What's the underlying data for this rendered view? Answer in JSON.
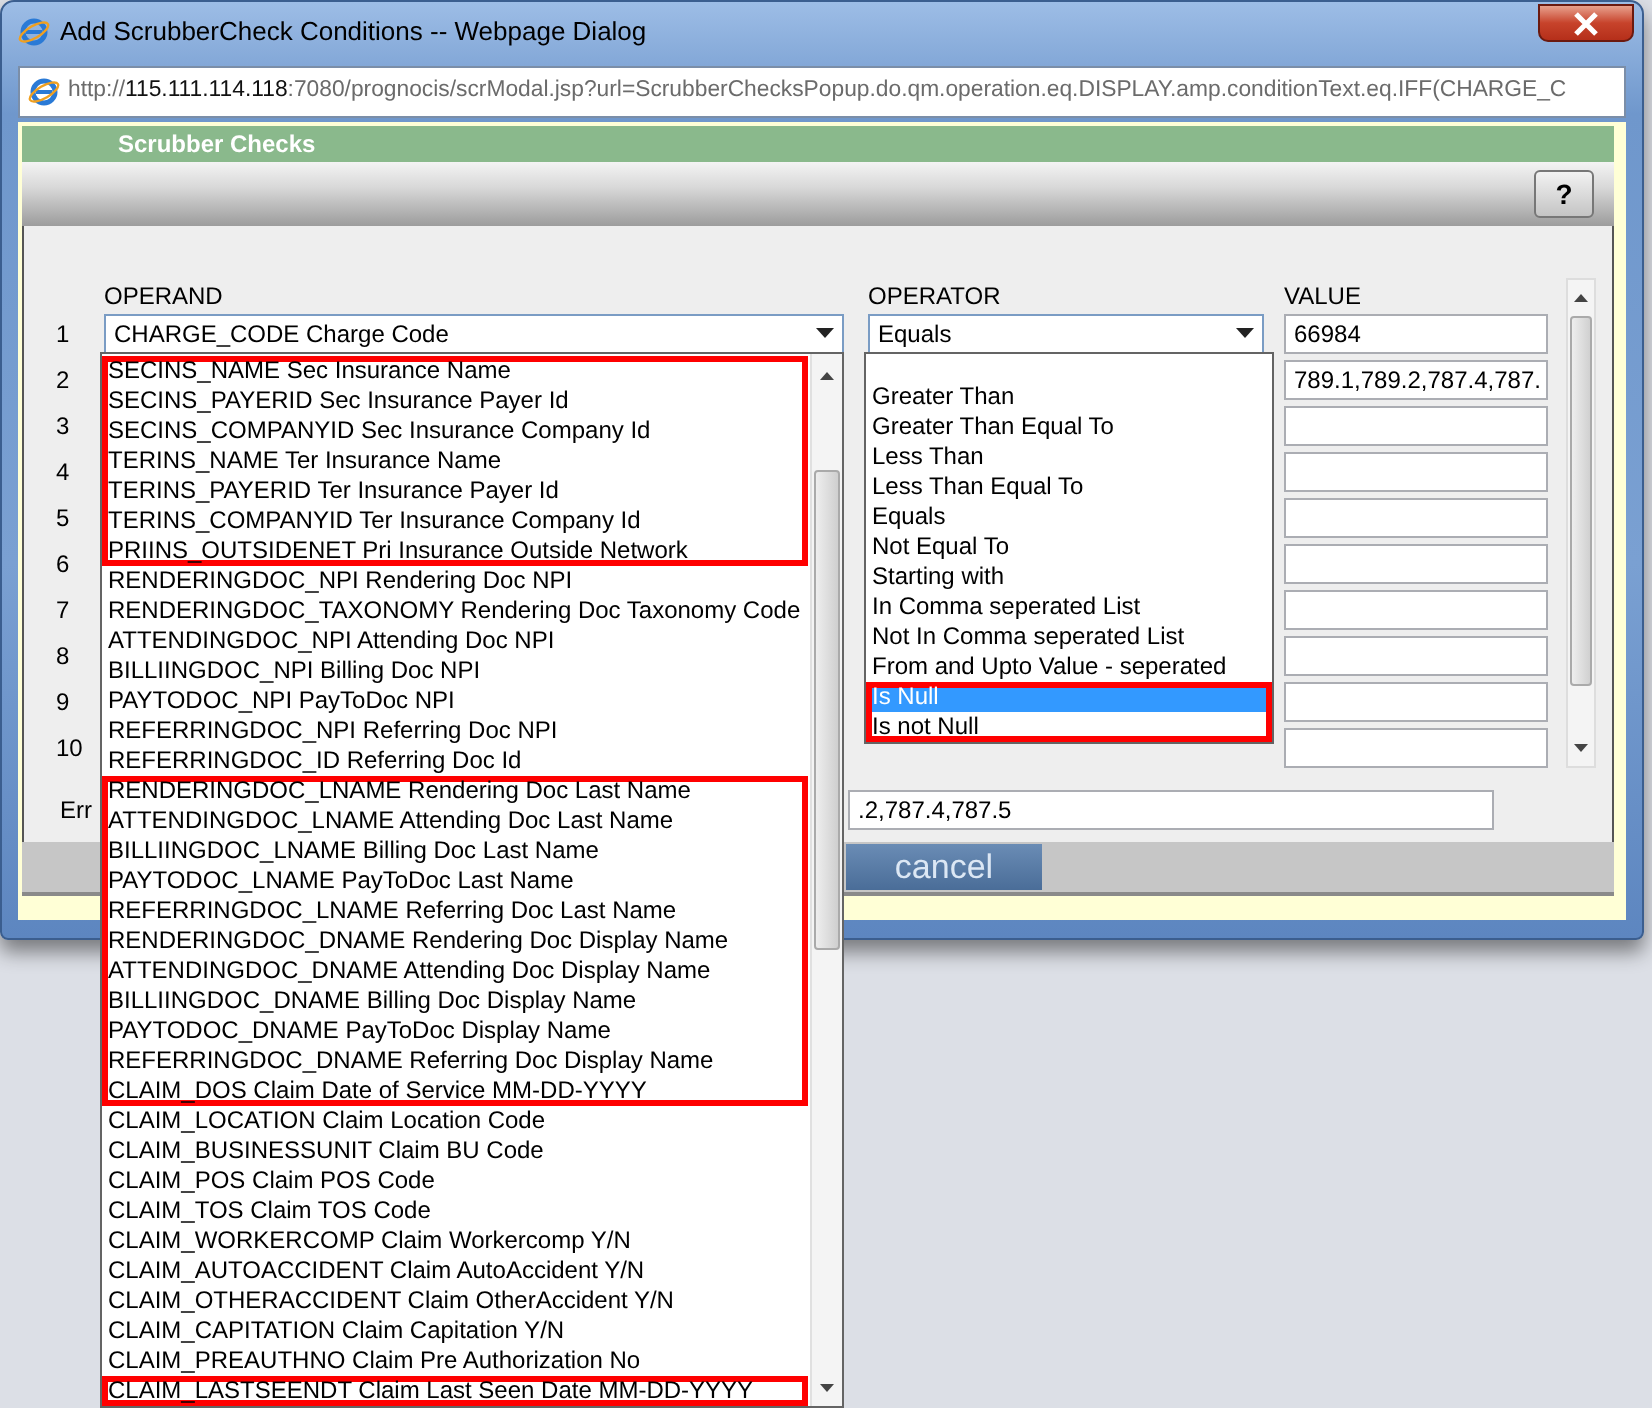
{
  "window": {
    "title": "Add ScrubberCheck Conditions -- Webpage Dialog"
  },
  "address": {
    "scheme": "http://",
    "host": "115.111.114.118",
    "rest": ":7080/prognocis/scrModal.jsp?url=ScrubberChecksPopup.do.qm.operation.eq.DISPLAY.amp.conditionText.eq.IFF(CHARGE_C"
  },
  "header": {
    "title": "Scrubber Checks",
    "help_button": "?"
  },
  "columns": [
    "OPERAND",
    "OPERATOR",
    "VALUE"
  ],
  "rows": [
    {
      "number": "1",
      "operand": "CHARGE_CODE Charge Code",
      "operator": "Equals",
      "value": "66984"
    },
    {
      "number": "2",
      "value": "789.1,789.2,787.4,787."
    },
    {
      "number": "3"
    },
    {
      "number": "4"
    },
    {
      "number": "5"
    },
    {
      "number": "6"
    },
    {
      "number": "7"
    },
    {
      "number": "8"
    },
    {
      "number": "9"
    },
    {
      "number": "10"
    }
  ],
  "error": {
    "label": "Err",
    "value": ".2,787.4,787.5"
  },
  "cancel_button": "cancel",
  "operand_list": {
    "items": [
      {
        "label": "SECINS_NAME Sec Insurance Name",
        "highlighted": true
      },
      {
        "label": "SECINS_PAYERID Sec Insurance Payer Id",
        "highlighted": true
      },
      {
        "label": "SECINS_COMPANYID Sec Insurance Company Id",
        "highlighted": true
      },
      {
        "label": "TERINS_NAME Ter Insurance Name",
        "highlighted": true
      },
      {
        "label": "TERINS_PAYERID Ter Insurance Payer Id",
        "highlighted": true
      },
      {
        "label": "TERINS_COMPANYID Ter Insurance Company Id",
        "highlighted": true
      },
      {
        "label": "PRIINS_OUTSIDENET Pri Insurance Outside Network",
        "highlighted": true
      },
      {
        "label": "RENDERINGDOC_NPI Rendering Doc NPI",
        "highlighted": false
      },
      {
        "label": "RENDERINGDOC_TAXONOMY Rendering Doc Taxonomy Code",
        "highlighted": false
      },
      {
        "label": "ATTENDINGDOC_NPI Attending Doc NPI",
        "highlighted": false
      },
      {
        "label": "BILLIINGDOC_NPI Billing Doc NPI",
        "highlighted": false
      },
      {
        "label": "PAYTODOC_NPI PayToDoc NPI",
        "highlighted": false
      },
      {
        "label": "REFERRINGDOC_NPI Referring Doc NPI",
        "highlighted": false
      },
      {
        "label": "REFERRINGDOC_ID Referring Doc Id",
        "highlighted": false
      },
      {
        "label": "RENDERINGDOC_LNAME Rendering Doc Last Name",
        "highlighted": true
      },
      {
        "label": "ATTENDINGDOC_LNAME Attending Doc Last Name",
        "highlighted": true
      },
      {
        "label": "BILLIINGDOC_LNAME Billing Doc Last Name",
        "highlighted": true
      },
      {
        "label": "PAYTODOC_LNAME PayToDoc Last Name",
        "highlighted": true
      },
      {
        "label": "REFERRINGDOC_LNAME Referring Doc Last Name",
        "highlighted": true
      },
      {
        "label": "RENDERINGDOC_DNAME Rendering Doc Display Name",
        "highlighted": true
      },
      {
        "label": "ATTENDINGDOC_DNAME Attending Doc Display Name",
        "highlighted": true
      },
      {
        "label": "BILLIINGDOC_DNAME Billing Doc Display Name",
        "highlighted": true
      },
      {
        "label": "PAYTODOC_DNAME PayToDoc Display Name",
        "highlighted": true
      },
      {
        "label": "REFERRINGDOC_DNAME Referring Doc Display Name",
        "highlighted": true
      },
      {
        "label": "CLAIM_DOS Claim Date of Service MM-DD-YYYY",
        "highlighted": true
      },
      {
        "label": "CLAIM_LOCATION Claim Location Code",
        "highlighted": false
      },
      {
        "label": "CLAIM_BUSINESSUNIT Claim BU Code",
        "highlighted": false
      },
      {
        "label": "CLAIM_POS Claim POS Code",
        "highlighted": false
      },
      {
        "label": "CLAIM_TOS Claim TOS Code",
        "highlighted": false
      },
      {
        "label": "CLAIM_WORKERCOMP Claim Workercomp Y/N",
        "highlighted": false
      },
      {
        "label": "CLAIM_AUTOACCIDENT Claim AutoAccident Y/N",
        "highlighted": false
      },
      {
        "label": "CLAIM_OTHERACCIDENT Claim OtherAccident Y/N",
        "highlighted": false
      },
      {
        "label": "CLAIM_CAPITATION Claim Capitation Y/N",
        "highlighted": false
      },
      {
        "label": "CLAIM_PREAUTHNO Claim Pre Authorization No",
        "highlighted": false
      },
      {
        "label": "CLAIM_LASTSEENDT Claim Last Seen Date MM-DD-YYYY",
        "highlighted": true
      }
    ]
  },
  "operator_list": {
    "items": [
      {
        "label": "Greater Than",
        "selected": false,
        "highlighted": false
      },
      {
        "label": "Greater Than Equal To",
        "selected": false,
        "highlighted": false
      },
      {
        "label": "Less Than",
        "selected": false,
        "highlighted": false
      },
      {
        "label": "Less Than Equal To",
        "selected": false,
        "highlighted": false
      },
      {
        "label": "Equals",
        "selected": false,
        "highlighted": false
      },
      {
        "label": "Not Equal To",
        "selected": false,
        "highlighted": false
      },
      {
        "label": "Starting with",
        "selected": false,
        "highlighted": false
      },
      {
        "label": "In Comma seperated List",
        "selected": false,
        "highlighted": false
      },
      {
        "label": "Not In Comma seperated List",
        "selected": false,
        "highlighted": false
      },
      {
        "label": "From and Upto Value - seperated",
        "selected": false,
        "highlighted": false
      },
      {
        "label": "Is Null",
        "selected": true,
        "highlighted": true
      },
      {
        "label": "Is not Null",
        "selected": false,
        "highlighted": true
      }
    ]
  }
}
